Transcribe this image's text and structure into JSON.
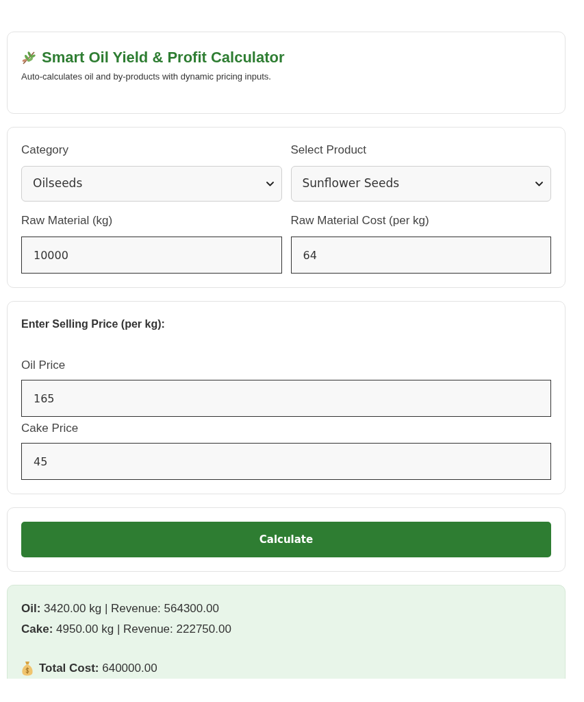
{
  "header": {
    "title": "Smart Oil Yield & Profit Calculator",
    "subtitle": "Auto-calculates oil and by-products with dynamic pricing inputs."
  },
  "inputs": {
    "fields": [
      {
        "kind": "select",
        "label": "Category",
        "value": "Oilseeds"
      },
      {
        "kind": "select",
        "label": "Select Product",
        "value": "Sunflower Seeds"
      },
      {
        "kind": "number",
        "label": "Raw Material (kg)",
        "value": "10000"
      },
      {
        "kind": "number",
        "label": "Raw Material Cost (per kg)",
        "value": "64"
      }
    ]
  },
  "pricing": {
    "heading": "Enter Selling Price (per kg):",
    "fields": [
      {
        "kind": "number",
        "label": "Oil Price",
        "value": "165"
      },
      {
        "kind": "number",
        "label": "Cake Price",
        "value": "45"
      }
    ]
  },
  "action": {
    "button": "Calculate"
  },
  "results": {
    "lines": [
      "**Oil:** 3420.00 kg | Revenue: 564300.00",
      "**Cake:** 4950.00 kg | Revenue: 222750.00"
    ],
    "total": "**Total Cost:** 640000.00"
  }
}
